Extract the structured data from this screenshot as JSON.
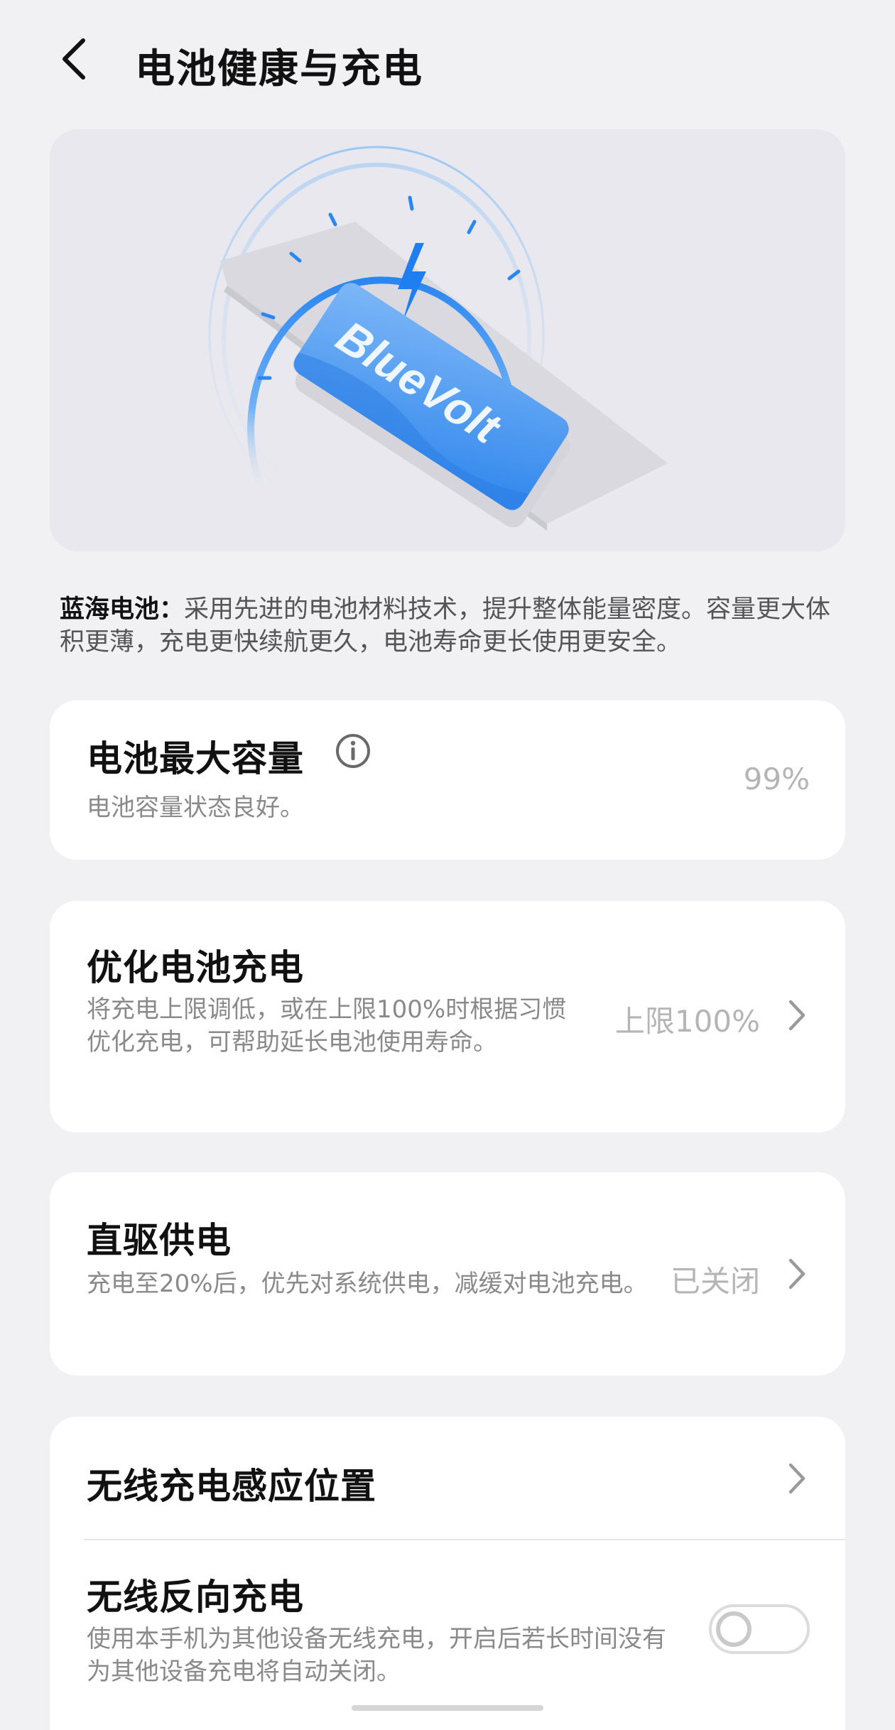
{
  "header": {
    "title": "电池健康与充电",
    "back_icon": "chevron-left-icon"
  },
  "hero": {
    "badge_text": "BlueVolt",
    "accent_color": "#2f8cf0"
  },
  "description": {
    "label": "蓝海电池：",
    "text": "采用先进的电池材料技术，提升整体能量密度。容量更大体积更薄，充电更快续航更久，电池寿命更长使用更安全。"
  },
  "battery_capacity": {
    "title": "电池最大容量",
    "info_icon": "info-icon",
    "subtitle": "电池容量状态良好。",
    "value": "99%"
  },
  "optimized_charging": {
    "title": "优化电池充电",
    "subtitle": "将充电上限调低，或在上限100%时根据习惯优化充电，可帮助延长电池使用寿命。",
    "value": "上限100%"
  },
  "direct_power": {
    "title": "直驱供电",
    "subtitle": "充电至20%后，优先对系统供电，减缓对电池充电。",
    "value": "已关闭"
  },
  "wireless": {
    "position_title": "无线充电感应位置",
    "reverse_title": "无线反向充电",
    "reverse_subtitle": "使用本手机为其他设备无线充电，开启后若长时间没有为其他设备充电将自动关闭。",
    "reverse_enabled": false
  }
}
